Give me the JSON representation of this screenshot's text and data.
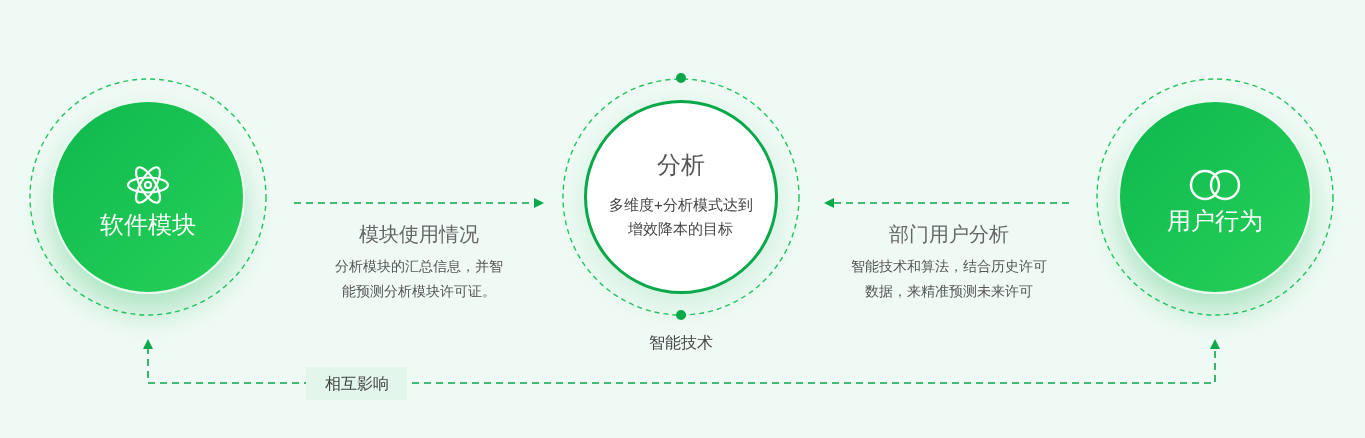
{
  "nodes": [
    {
      "kind": "filled",
      "title": "软件模块"
    },
    {
      "kind": "outline",
      "title": "分析",
      "description": [
        "多维度+分析模式达到",
        "增效降本的目标"
      ],
      "caption": "智能技术"
    },
    {
      "kind": "filled",
      "title": "用户行为"
    }
  ],
  "links": [
    {
      "kind": "rightward",
      "title": "模块使用情况",
      "description": [
        "分析模块的汇总信息，并智",
        "能预测分析模块许可证。"
      ]
    },
    {
      "kind": "leftward",
      "title": "部门用户分析",
      "description": [
        "智能技术和算法，结合历史许可",
        "数据，来精准预测未来许可"
      ]
    }
  ],
  "feedback_label": "相互影响"
}
